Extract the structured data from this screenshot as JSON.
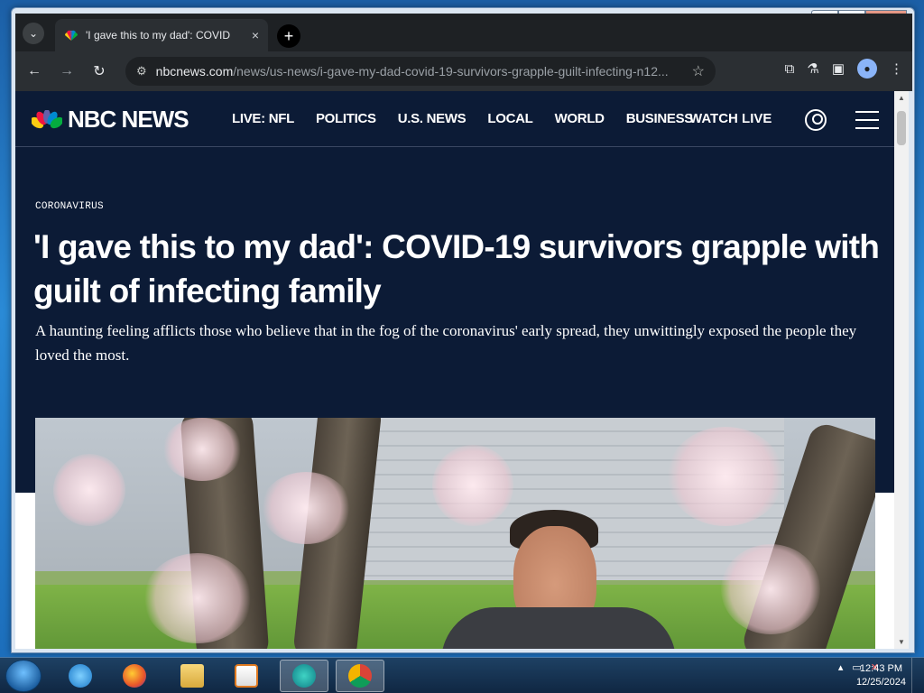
{
  "browser": {
    "tab_title": "'I gave this to my dad': COVID",
    "tab_close": "×",
    "new_tab": "+",
    "url_host": "nbcnews.com",
    "url_path": "/news/us-news/i-gave-my-dad-covid-19-survivors-grapple-guilt-infecting-n12...",
    "back": "←",
    "forward": "→",
    "reload": "↻"
  },
  "window": {
    "minimize": "▁",
    "maximize": "□",
    "close": "✕"
  },
  "site": {
    "logo_text": "NBC NEWS",
    "nav": [
      "LIVE: NFL",
      "POLITICS",
      "U.S. NEWS",
      "LOCAL",
      "WORLD",
      "BUSINESS"
    ],
    "watch_live": "WATCH LIVE"
  },
  "article": {
    "kicker": "CORONAVIRUS",
    "headline": "'I gave this to my dad': COVID-19 survivors grapple with guilt of infecting family",
    "dek": "A haunting feeling afflicts those who believe that in the fog of the coronavirus' early spread, they unwittingly exposed the people they loved the most."
  },
  "taskbar": {
    "time": "12:43 PM",
    "date": "12/25/2024",
    "apps": [
      "internet-explorer",
      "firefox",
      "file-explorer",
      "media-player",
      "app-5",
      "chrome"
    ]
  },
  "colors": {
    "nbc_navy": "#0c1b36",
    "chrome_dark": "#1e2124"
  }
}
